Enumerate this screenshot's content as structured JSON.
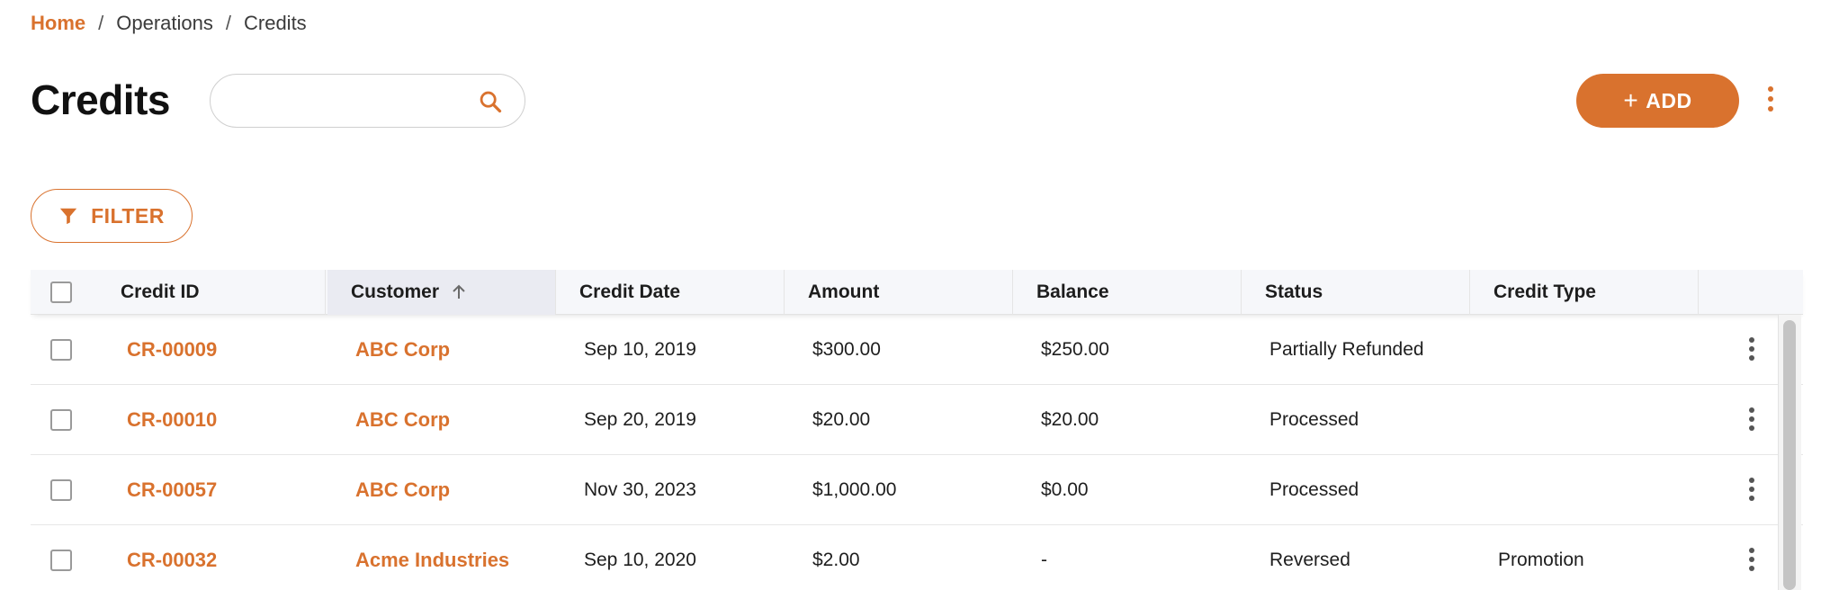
{
  "breadcrumb": {
    "home": "Home",
    "section": "Operations",
    "current": "Credits",
    "separator": "/"
  },
  "page": {
    "title": "Credits"
  },
  "search": {
    "value": "",
    "placeholder": "",
    "icon": "search-icon"
  },
  "toolbar": {
    "add_plus": "+",
    "add_label": "ADD",
    "more_icon": "vertical-dots-icon",
    "filter_label": "FILTER",
    "filter_icon": "funnel-icon"
  },
  "colors": {
    "accent": "#d9722e",
    "header_bg": "#f6f7fa",
    "sorted_header_bg": "#eaebf2"
  },
  "table": {
    "columns": [
      {
        "label": "Credit ID"
      },
      {
        "label": "Customer",
        "sort": "ascending"
      },
      {
        "label": "Credit Date"
      },
      {
        "label": "Amount"
      },
      {
        "label": "Balance"
      },
      {
        "label": "Status"
      },
      {
        "label": "Credit Type"
      }
    ],
    "rows": [
      {
        "credit_id": "CR-00009",
        "customer": "ABC Corp",
        "date": "Sep 10, 2019",
        "amount": "$300.00",
        "balance": "$250.00",
        "status": "Partially Refunded",
        "type": ""
      },
      {
        "credit_id": "CR-00010",
        "customer": "ABC Corp",
        "date": "Sep 20, 2019",
        "amount": "$20.00",
        "balance": "$20.00",
        "status": "Processed",
        "type": ""
      },
      {
        "credit_id": "CR-00057",
        "customer": "ABC Corp",
        "date": "Nov 30, 2023",
        "amount": "$1,000.00",
        "balance": "$0.00",
        "status": "Processed",
        "type": ""
      },
      {
        "credit_id": "CR-00032",
        "customer": "Acme Industries",
        "date": "Sep 10, 2020",
        "amount": "$2.00",
        "balance": "-",
        "status": "Reversed",
        "type": "Promotion"
      }
    ]
  }
}
